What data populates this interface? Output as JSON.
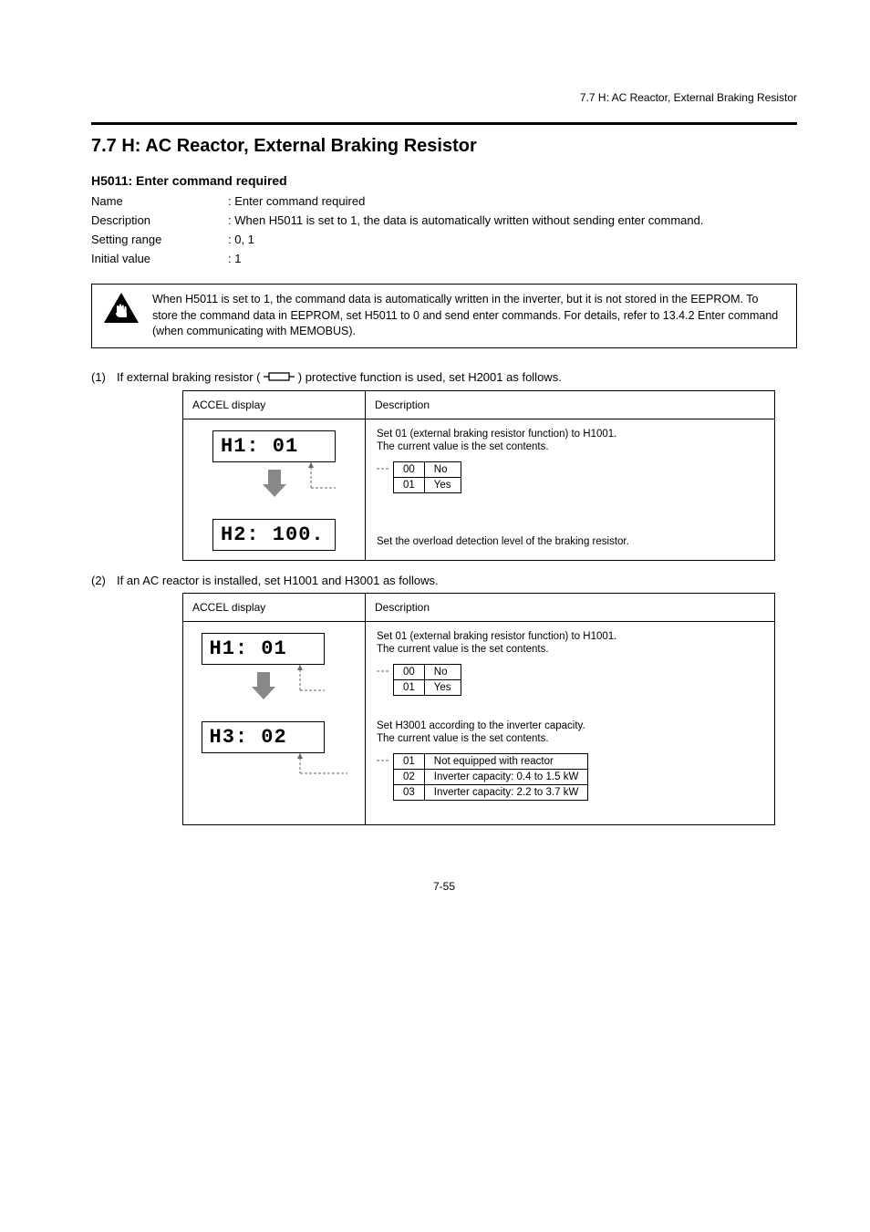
{
  "header_top": "7.7 H: AC Reactor, External Braking Resistor",
  "section_title": "7.7 H: AC Reactor, External Braking Resistor",
  "h5011": {
    "heading": "H5011: Enter command required",
    "name_label": "Name",
    "name_value": ": Enter command required",
    "desc_label": "Description",
    "desc_value": ": When H5011 is set to 1, the data is automatically written without sending enter command.",
    "range_label": "Setting range",
    "range_value": ": 0, 1",
    "init_label": "Initial value",
    "init_value": ": 1"
  },
  "caution": "When H5011 is set to 1, the command data is automatically written in the inverter, but it is not stored in the EEPROM. To store the command data in EEPROM, set H5011 to 0 and send enter commands. For details, refer to 13.4.2 Enter command (when communicating with MEMOBUS).",
  "list1": {
    "num": "(1)",
    "text_a": "If external braking resistor (",
    "text_b": ") protective function is used, set H2001 as follows."
  },
  "block1": {
    "hdr1": "ACCEL display",
    "hdr2": "Description",
    "lcd1": "H1:  01",
    "lcd2": "H2: 100.",
    "desc1_line1": "Set 01 (external braking resistor function) to H1001.",
    "desc1_line2": "The current value is the set contents.",
    "table": [
      [
        "00",
        "No"
      ],
      [
        "01",
        "Yes"
      ]
    ],
    "desc2": "Set the overload detection level of the braking resistor."
  },
  "list2": {
    "num": "(2)",
    "text": "If an AC reactor is installed, set H1001 and H3001 as follows."
  },
  "block2": {
    "hdr1": "ACCEL display",
    "hdr2": "Description",
    "lcd1": "H1:  01",
    "lcd2": "H3:  02",
    "desc1_line1": "Set 01 (external braking resistor function) to H1001.",
    "desc1_line2": "The current value is the set contents.",
    "table1": [
      [
        "00",
        "No"
      ],
      [
        "01",
        "Yes"
      ]
    ],
    "desc2_line1": "Set H3001 according to the inverter capacity.",
    "desc2_line2": "The current value is the set contents.",
    "table2": [
      [
        "01",
        "Not equipped with reactor"
      ],
      [
        "02",
        "Inverter capacity: 0.4 to 1.5 kW"
      ],
      [
        "03",
        "Inverter capacity: 2.2 to 3.7 kW"
      ]
    ]
  },
  "footer": "7-55"
}
